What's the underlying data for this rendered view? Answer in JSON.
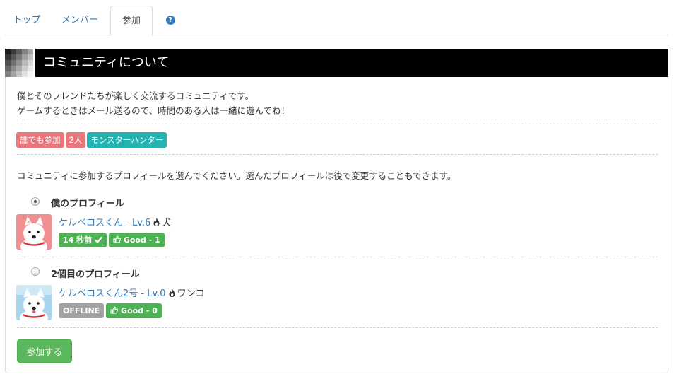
{
  "tabs": [
    {
      "label": "トップ"
    },
    {
      "label": "メンバー"
    },
    {
      "label": "参加"
    }
  ],
  "panel": {
    "title": "コミュニティについて",
    "description_lines": [
      "僕とそのフレンドたちが楽しく交流するコミュニティです。",
      "ゲームするときはメール送るので、時間のある人は一緒に遊んでね！"
    ],
    "tags": [
      "誰でも参加",
      "2人",
      "モンスターハンター"
    ],
    "instruction": "コミュニティに参加するプロフィールを選んでください。選んだプロフィールは後で変更することもできます。",
    "profiles": [
      {
        "name": "僕のプロフィール",
        "selected": true,
        "character_link": "ケルベロスくん - Lv.6",
        "character_type": "犬",
        "status": "14 秒前",
        "status_icon": "check-icon",
        "good": "Good - 1",
        "avatar_bg": "#ef8f92"
      },
      {
        "name": "2個目のプロフィール",
        "selected": false,
        "character_link": "ケルベロスくん2号 - Lv.0",
        "character_type": "ワンコ",
        "status": "OFFLINE",
        "good": "Good - 0",
        "avatar_bg": "#a8d4ee"
      }
    ],
    "join_button": "参加する"
  },
  "colors": {
    "link": "#337ab7",
    "tag_red": "#e9767a",
    "tag_teal": "#24b3b0",
    "badge_green": "#4cb253",
    "badge_gray": "#a2a2a2",
    "button_green": "#5cb85c",
    "header_bg": "#000000"
  }
}
